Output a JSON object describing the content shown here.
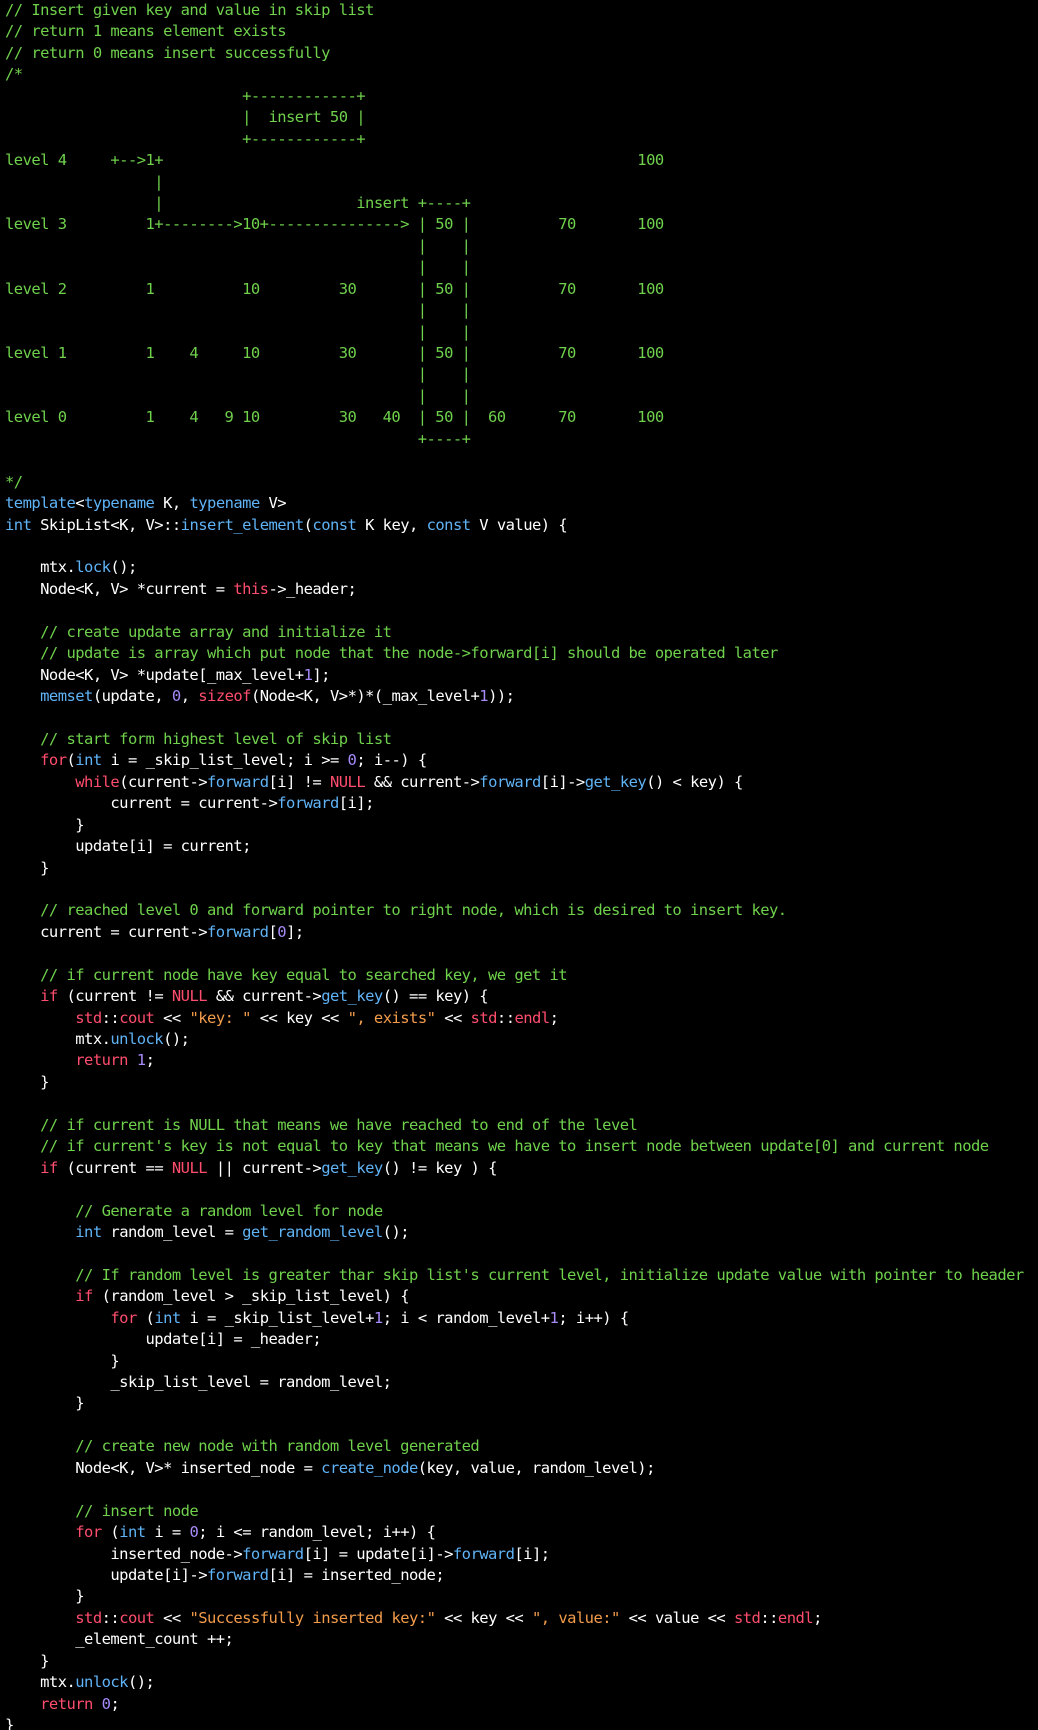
{
  "editor": {
    "colors": {
      "background": "#000000",
      "plain": "#ffffff",
      "comment": "#6fd14c",
      "keyword": "#5fb3f6",
      "function": "#5fb3f6",
      "control": "#ff4d6d",
      "number": "#a78bfa",
      "string": "#f39c4a"
    },
    "lines": [
      [
        [
          "c",
          "// Insert given key and value in skip list"
        ]
      ],
      [
        [
          "c",
          "// return 1 means element exists"
        ]
      ],
      [
        [
          "c",
          "// return 0 means insert successfully"
        ]
      ],
      [
        [
          "c",
          "/*"
        ]
      ],
      [
        [
          "c",
          "                           +------------+"
        ]
      ],
      [
        [
          "c",
          "                           |  insert 50 |"
        ]
      ],
      [
        [
          "c",
          "                           +------------+"
        ]
      ],
      [
        [
          "c",
          "level 4     +-->1+                                                      100"
        ]
      ],
      [
        [
          "c",
          "                 |"
        ]
      ],
      [
        [
          "c",
          "                 |                      insert +----+"
        ]
      ],
      [
        [
          "c",
          "level 3         1+-------->10+---------------> | 50 |          70       100"
        ]
      ],
      [
        [
          "c",
          "                                               |    |"
        ]
      ],
      [
        [
          "c",
          "                                               |    |"
        ]
      ],
      [
        [
          "c",
          "level 2         1          10         30       | 50 |          70       100"
        ]
      ],
      [
        [
          "c",
          "                                               |    |"
        ]
      ],
      [
        [
          "c",
          "                                               |    |"
        ]
      ],
      [
        [
          "c",
          "level 1         1    4     10         30       | 50 |          70       100"
        ]
      ],
      [
        [
          "c",
          "                                               |    |"
        ]
      ],
      [
        [
          "c",
          "                                               |    |"
        ]
      ],
      [
        [
          "c",
          "level 0         1    4   9 10         30   40  | 50 |  60      70       100"
        ]
      ],
      [
        [
          "c",
          "                                               +----+"
        ]
      ],
      [],
      [
        [
          "c",
          "*/"
        ]
      ],
      [
        [
          "k",
          "template"
        ],
        [
          "p",
          "<"
        ],
        [
          "k",
          "typename"
        ],
        [
          "p",
          " K, "
        ],
        [
          "k",
          "typename"
        ],
        [
          "p",
          " V>"
        ]
      ],
      [
        [
          "k",
          "int"
        ],
        [
          "p",
          " SkipList<K, V>::"
        ],
        [
          "f",
          "insert_element"
        ],
        [
          "p",
          "("
        ],
        [
          "k",
          "const"
        ],
        [
          "p",
          " K key, "
        ],
        [
          "k",
          "const"
        ],
        [
          "p",
          " V value) {"
        ]
      ],
      [],
      [
        [
          "p",
          "    mtx."
        ],
        [
          "f",
          "lock"
        ],
        [
          "p",
          "();"
        ]
      ],
      [
        [
          "p",
          "    Node<K, V> *current = "
        ],
        [
          "r",
          "this"
        ],
        [
          "p",
          "->_header;"
        ]
      ],
      [],
      [
        [
          "c",
          "    // create update array and initialize it"
        ]
      ],
      [
        [
          "c",
          "    // update is array which put node that the node->forward[i] should be operated later"
        ]
      ],
      [
        [
          "p",
          "    Node<K, V> *update[_max_level+"
        ],
        [
          "n",
          "1"
        ],
        [
          "p",
          "];"
        ]
      ],
      [
        [
          "p",
          "    "
        ],
        [
          "f",
          "memset"
        ],
        [
          "p",
          "(update, "
        ],
        [
          "n",
          "0"
        ],
        [
          "p",
          ", "
        ],
        [
          "r",
          "sizeof"
        ],
        [
          "p",
          "(Node<K, V>*)*(_max_level+"
        ],
        [
          "n",
          "1"
        ],
        [
          "p",
          "));"
        ]
      ],
      [],
      [
        [
          "c",
          "    // start form highest level of skip list"
        ]
      ],
      [
        [
          "p",
          "    "
        ],
        [
          "r",
          "for"
        ],
        [
          "p",
          "("
        ],
        [
          "k",
          "int"
        ],
        [
          "p",
          " i = _skip_list_level; i >= "
        ],
        [
          "n",
          "0"
        ],
        [
          "p",
          "; i--) {"
        ]
      ],
      [
        [
          "p",
          "        "
        ],
        [
          "r",
          "while"
        ],
        [
          "p",
          "(current->"
        ],
        [
          "f",
          "forward"
        ],
        [
          "p",
          "[i] != "
        ],
        [
          "r",
          "NULL"
        ],
        [
          "p",
          " && current->"
        ],
        [
          "f",
          "forward"
        ],
        [
          "p",
          "[i]->"
        ],
        [
          "f",
          "get_key"
        ],
        [
          "p",
          "() < key) {"
        ]
      ],
      [
        [
          "p",
          "            current = current->"
        ],
        [
          "f",
          "forward"
        ],
        [
          "p",
          "[i];"
        ]
      ],
      [
        [
          "p",
          "        }"
        ]
      ],
      [
        [
          "p",
          "        update[i] = current;"
        ]
      ],
      [
        [
          "p",
          "    }"
        ]
      ],
      [],
      [
        [
          "c",
          "    // reached level 0 and forward pointer to right node, which is desired to insert key."
        ]
      ],
      [
        [
          "p",
          "    current = current->"
        ],
        [
          "f",
          "forward"
        ],
        [
          "p",
          "["
        ],
        [
          "n",
          "0"
        ],
        [
          "p",
          "];"
        ]
      ],
      [],
      [
        [
          "c",
          "    // if current node have key equal to searched key, we get it"
        ]
      ],
      [
        [
          "p",
          "    "
        ],
        [
          "r",
          "if"
        ],
        [
          "p",
          " (current != "
        ],
        [
          "r",
          "NULL"
        ],
        [
          "p",
          " && current->"
        ],
        [
          "f",
          "get_key"
        ],
        [
          "p",
          "() == key) {"
        ]
      ],
      [
        [
          "p",
          "        "
        ],
        [
          "r",
          "std"
        ],
        [
          "p",
          "::"
        ],
        [
          "r",
          "cout"
        ],
        [
          "p",
          " << "
        ],
        [
          "s",
          "\"key: \""
        ],
        [
          "p",
          " << key << "
        ],
        [
          "s",
          "\", exists\""
        ],
        [
          "p",
          " << "
        ],
        [
          "r",
          "std"
        ],
        [
          "p",
          "::"
        ],
        [
          "r",
          "endl"
        ],
        [
          "p",
          ";"
        ]
      ],
      [
        [
          "p",
          "        mtx."
        ],
        [
          "f",
          "unlock"
        ],
        [
          "p",
          "();"
        ]
      ],
      [
        [
          "p",
          "        "
        ],
        [
          "r",
          "return"
        ],
        [
          "p",
          " "
        ],
        [
          "n",
          "1"
        ],
        [
          "p",
          ";"
        ]
      ],
      [
        [
          "p",
          "    }"
        ]
      ],
      [],
      [
        [
          "c",
          "    // if current is NULL that means we have reached to end of the level"
        ]
      ],
      [
        [
          "c",
          "    // if current's key is not equal to key that means we have to insert node between update[0] and current node"
        ]
      ],
      [
        [
          "p",
          "    "
        ],
        [
          "r",
          "if"
        ],
        [
          "p",
          " (current == "
        ],
        [
          "r",
          "NULL"
        ],
        [
          "p",
          " || current->"
        ],
        [
          "f",
          "get_key"
        ],
        [
          "p",
          "() != key ) {"
        ]
      ],
      [],
      [
        [
          "c",
          "        // Generate a random level for node"
        ]
      ],
      [
        [
          "p",
          "        "
        ],
        [
          "k",
          "int"
        ],
        [
          "p",
          " random_level = "
        ],
        [
          "f",
          "get_random_level"
        ],
        [
          "p",
          "();"
        ]
      ],
      [],
      [
        [
          "c",
          "        // If random level is greater thar skip list's current level, initialize update value with pointer to header"
        ]
      ],
      [
        [
          "p",
          "        "
        ],
        [
          "r",
          "if"
        ],
        [
          "p",
          " (random_level > _skip_list_level) {"
        ]
      ],
      [
        [
          "p",
          "            "
        ],
        [
          "r",
          "for"
        ],
        [
          "p",
          " ("
        ],
        [
          "k",
          "int"
        ],
        [
          "p",
          " i = _skip_list_level+"
        ],
        [
          "n",
          "1"
        ],
        [
          "p",
          "; i < random_level+"
        ],
        [
          "n",
          "1"
        ],
        [
          "p",
          "; i++) {"
        ]
      ],
      [
        [
          "p",
          "                update[i] = _header;"
        ]
      ],
      [
        [
          "p",
          "            }"
        ]
      ],
      [
        [
          "p",
          "            _skip_list_level = random_level;"
        ]
      ],
      [
        [
          "p",
          "        }"
        ]
      ],
      [],
      [
        [
          "c",
          "        // create new node with random level generated"
        ]
      ],
      [
        [
          "p",
          "        Node<K, V>* inserted_node = "
        ],
        [
          "f",
          "create_node"
        ],
        [
          "p",
          "(key, value, random_level);"
        ]
      ],
      [],
      [
        [
          "c",
          "        // insert node"
        ]
      ],
      [
        [
          "p",
          "        "
        ],
        [
          "r",
          "for"
        ],
        [
          "p",
          " ("
        ],
        [
          "k",
          "int"
        ],
        [
          "p",
          " i = "
        ],
        [
          "n",
          "0"
        ],
        [
          "p",
          "; i <= random_level; i++) {"
        ]
      ],
      [
        [
          "p",
          "            inserted_node->"
        ],
        [
          "f",
          "forward"
        ],
        [
          "p",
          "[i] = update[i]->"
        ],
        [
          "f",
          "forward"
        ],
        [
          "p",
          "[i];"
        ]
      ],
      [
        [
          "p",
          "            update[i]->"
        ],
        [
          "f",
          "forward"
        ],
        [
          "p",
          "[i] = inserted_node;"
        ]
      ],
      [
        [
          "p",
          "        }"
        ]
      ],
      [
        [
          "p",
          "        "
        ],
        [
          "r",
          "std"
        ],
        [
          "p",
          "::"
        ],
        [
          "r",
          "cout"
        ],
        [
          "p",
          " << "
        ],
        [
          "s",
          "\"Successfully inserted key:\""
        ],
        [
          "p",
          " << key << "
        ],
        [
          "s",
          "\", value:\""
        ],
        [
          "p",
          " << value << "
        ],
        [
          "r",
          "std"
        ],
        [
          "p",
          "::"
        ],
        [
          "r",
          "endl"
        ],
        [
          "p",
          ";"
        ]
      ],
      [
        [
          "p",
          "        _element_count ++;"
        ]
      ],
      [
        [
          "p",
          "    }"
        ]
      ],
      [
        [
          "p",
          "    mtx."
        ],
        [
          "f",
          "unlock"
        ],
        [
          "p",
          "();"
        ]
      ],
      [
        [
          "p",
          "    "
        ],
        [
          "r",
          "return"
        ],
        [
          "p",
          " "
        ],
        [
          "n",
          "0"
        ],
        [
          "p",
          ";"
        ]
      ],
      [
        [
          "p",
          "}"
        ]
      ]
    ]
  }
}
